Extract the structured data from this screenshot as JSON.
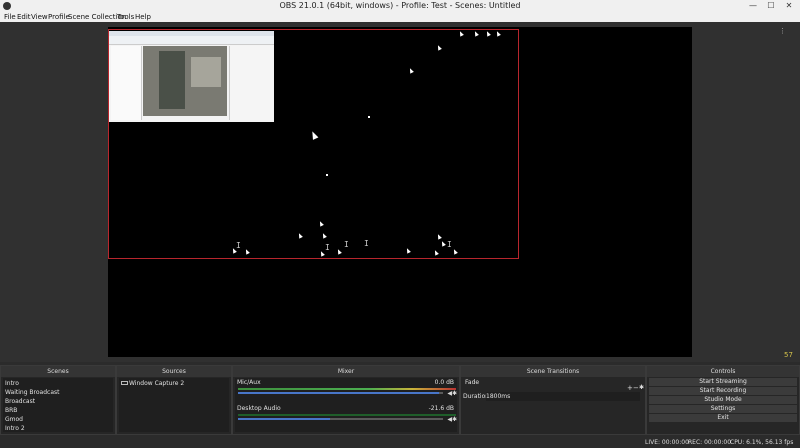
{
  "window": {
    "title": "OBS 21.0.1 (64bit, windows) - Profile: Test - Scenes: Untitled",
    "minimize_glyph": "—",
    "maximize_glyph": "☐",
    "close_glyph": "✕"
  },
  "menu": [
    "File",
    "Edit",
    "View",
    "Profile",
    "Scene Collection",
    "Tools",
    "Help"
  ],
  "preview": {
    "corner_readout": "57",
    "studio_dots_glyph": "⋮"
  },
  "docks": {
    "scenes": {
      "title": "Scenes",
      "items": [
        "Intro",
        "Waiting Broadcast",
        "Broadcast",
        "BRB",
        "Gmod",
        "Intro 2"
      ]
    },
    "sources": {
      "title": "Sources",
      "items": [
        "Window Capture 2"
      ]
    },
    "mixer": {
      "title": "Mixer",
      "channels": [
        {
          "name": "Mic/Aux",
          "db": "0.0 dB",
          "volume": 0.98
        },
        {
          "name": "Desktop Audio",
          "db": "-21.6 dB",
          "volume": 0.45
        }
      ]
    },
    "transitions": {
      "title": "Scene Transitions",
      "selected": "Fade",
      "duration_label": "Duration",
      "duration_value": "1800ms"
    },
    "controls": {
      "title": "Controls",
      "buttons": [
        "Start Streaming",
        "Start Recording",
        "Studio Mode",
        "Settings",
        "Exit"
      ]
    }
  },
  "status": {
    "live": "LIVE: 00:00:00",
    "rec": "REC: 00:00:00",
    "cpu": "CPU: 6.1%, 56.13 fps"
  },
  "colors": {
    "bounding_box": "#b8262d",
    "volume_slider": "#4876c9",
    "meter_green": "#4caf50"
  }
}
